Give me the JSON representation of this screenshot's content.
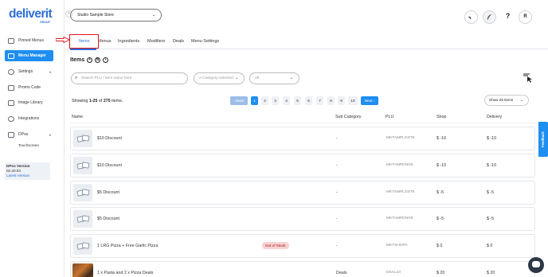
{
  "brand": {
    "name": "deliverit",
    "sub": "GROUP"
  },
  "sidebar": {
    "items": [
      {
        "label": "Pinned Menus"
      },
      {
        "label": "Menu Manager"
      },
      {
        "label": "Settings"
      },
      {
        "label": "Promo Code"
      },
      {
        "label": "Image Library"
      },
      {
        "label": "Integrations"
      },
      {
        "label": "DPos"
      },
      {
        "label": "Touchscreen"
      }
    ],
    "version": {
      "title": "DPos Version",
      "number": "02.20.03",
      "link": "Latest Version"
    }
  },
  "topbar": {
    "store": "Studio Sample Store",
    "avatar": "R",
    "help": "?"
  },
  "tabs": [
    "Items",
    "Menus",
    "Ingredients",
    "Modifiers",
    "Deals",
    "Menu Settings"
  ],
  "section": {
    "title": "Items"
  },
  "filters": {
    "search_placeholder": "Search PLU / Item name here",
    "category": "A Category selected",
    "status": "All"
  },
  "pagination": {
    "showing_prefix": "Showing",
    "range": "1-25",
    "of": "of",
    "total": "275",
    "suffix": "items.",
    "prev": "‹ Back",
    "next": "Next ›",
    "pages": [
      "1",
      "2",
      "3",
      "4",
      "5",
      "6",
      "7",
      "8",
      "9",
      "10"
    ],
    "per_page": "Show 25 items"
  },
  "table": {
    "headers": [
      "Name",
      "Sub Category",
      "PLU",
      "Shop",
      "Delivery"
    ],
    "rows": [
      {
        "name": "$10 Discount",
        "sub": "-",
        "plu": "MKTAMPLOST6",
        "shop": "$ -10",
        "delivery": "$ -10",
        "badge": ""
      },
      {
        "name": "$10 Discount",
        "sub": "-",
        "plu": "MKTAMPDNG6",
        "shop": "$ -10",
        "delivery": "$ -10",
        "badge": ""
      },
      {
        "name": "$5 Discount",
        "sub": "-",
        "plu": "MKTAMPLOST5",
        "shop": "$ -5",
        "delivery": "$ -5",
        "badge": ""
      },
      {
        "name": "$5 Discount",
        "sub": "-",
        "plu": "MKTAMPDNG5",
        "shop": "$ -5",
        "delivery": "$ -5",
        "badge": ""
      },
      {
        "name": "1 LRG Pizza + Free Garlic Pizza",
        "sub": "-",
        "plu": "MKTSHOPA",
        "shop": "$ 0",
        "delivery": "$ 0",
        "badge": "Out of Stock"
      },
      {
        "name": "1 x Pasta and 2 x Pizza Deals",
        "sub": "Deals",
        "plu": "DEAL10",
        "shop": "$ 20",
        "delivery": "$ 20",
        "badge": ""
      }
    ]
  },
  "feedback": "Feedback"
}
